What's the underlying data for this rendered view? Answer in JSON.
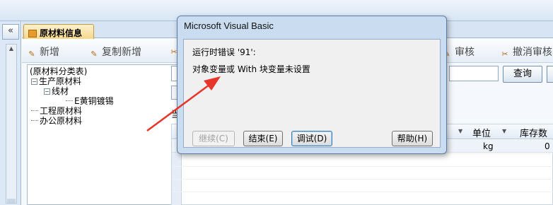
{
  "toolbar_strip": {},
  "left_nav": {
    "collapse_label": "«"
  },
  "tab": {
    "label": "原材料信息"
  },
  "toolbar": {
    "new_label": "新增",
    "copy_new_label": "复制新增",
    "approve_label": "审核",
    "cancel_approve_label": "撤消审核"
  },
  "tree": {
    "root": "(原材料分类表)",
    "items": [
      {
        "label": "生产原材料",
        "marker": "−"
      },
      {
        "label": "线材",
        "marker": "−"
      },
      {
        "label": "E黄铜镀锡"
      },
      {
        "label": "工程原材料"
      },
      {
        "label": "办公原材料"
      }
    ]
  },
  "right_pane": {
    "query_label": "查询",
    "small_text": "当",
    "grid": {
      "headers": [
        "单位",
        "库存数"
      ],
      "row": {
        "unit": "kg",
        "stock": "0"
      }
    }
  },
  "dialog": {
    "title": "Microsoft Visual Basic",
    "error_line": "运行时错误 '91':",
    "message": "对象变量或 With 块变量未设置",
    "buttons": {
      "continue": "继续(C)",
      "end": "结束(E)",
      "debug": "调试(D)",
      "help": "帮助(H)"
    }
  },
  "colors": {
    "arrow": "#e8352a",
    "tab_fill": "#f7d78a",
    "dialog_frame": "#c9dcf0"
  }
}
